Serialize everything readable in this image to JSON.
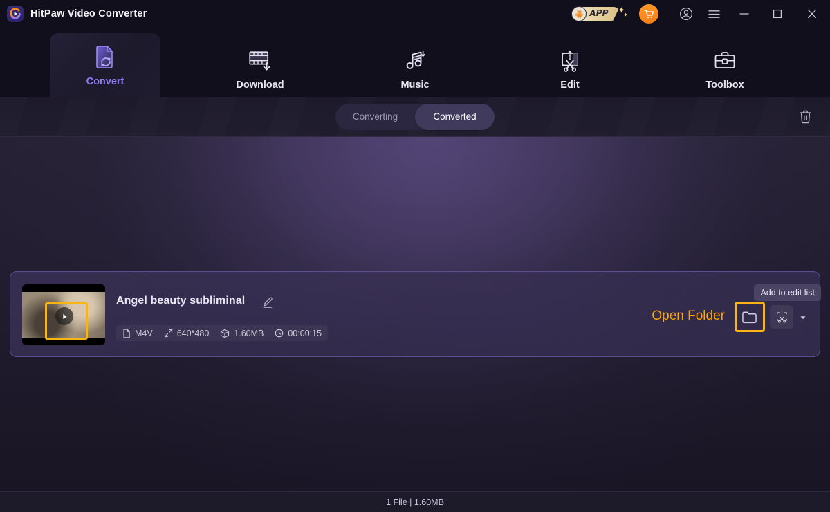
{
  "window": {
    "title": "HitPaw Video Converter",
    "logo_icon": "hitpaw-logo-icon",
    "app_badge": {
      "label": "APP",
      "icon": "android-icon",
      "sparkle_icon": "sparkle-icon"
    },
    "cart_icon": "shopping-cart-icon",
    "account_icon": "account-circle-icon",
    "menu_icon": "hamburger-menu-icon",
    "minimize_icon": "minimize-icon",
    "maximize_icon": "maximize-icon",
    "close_icon": "close-icon"
  },
  "nav": {
    "tabs": [
      {
        "label": "Convert",
        "icon": "convert-file-icon",
        "active": true
      },
      {
        "label": "Download",
        "icon": "film-download-icon",
        "active": false
      },
      {
        "label": "Music",
        "icon": "music-note-download-icon",
        "active": false
      },
      {
        "label": "Edit",
        "icon": "scissors-crop-icon",
        "active": false
      },
      {
        "label": "Toolbox",
        "icon": "toolbox-icon",
        "active": false
      }
    ],
    "active_color": "#8f7bf2"
  },
  "toolbar": {
    "segments": [
      {
        "label": "Converting",
        "selected": false
      },
      {
        "label": "Converted",
        "selected": true
      }
    ],
    "delete_icon": "trash-icon",
    "highlight_color": "#fcb415"
  },
  "file_card": {
    "title": "Angel beauty subliminal",
    "edit_name_icon": "pencil-icon",
    "play_icon": "play-icon",
    "meta": [
      {
        "icon": "file-icon",
        "value": "M4V"
      },
      {
        "icon": "resolution-icon",
        "value": "640*480"
      },
      {
        "icon": "package-icon",
        "value": "1.60MB"
      },
      {
        "icon": "clock-icon",
        "value": "00:00:15"
      }
    ],
    "open_folder_label": "Open Folder",
    "folder_icon": "folder-icon",
    "edit_list_icon": "scissors-crop-icon",
    "dropdown_icon": "chevron-down-icon",
    "tooltip": "Add to edit list",
    "annotation_color": "#ffa400"
  },
  "statusbar": {
    "text": "1 File | 1.60MB"
  }
}
